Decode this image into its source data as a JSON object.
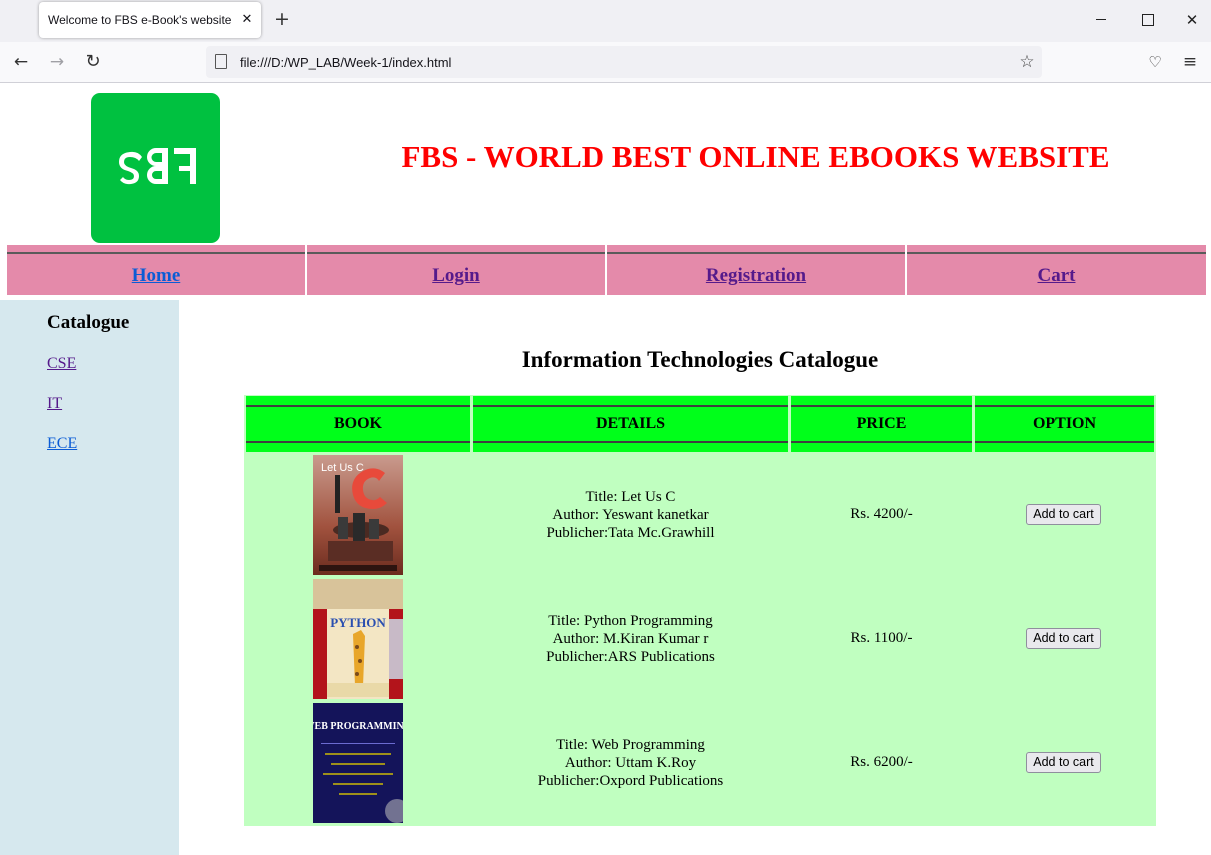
{
  "browser": {
    "tab_title": "Welcome to FBS e-Book's website",
    "tab_close": "✕",
    "new_tab": "+",
    "url": "file:///D:/WP_LAB/Week-1/index.html"
  },
  "header": {
    "logo_text": "FBS",
    "site_title": "FBS - WORLD BEST ONLINE EBOOKS WEBSITE"
  },
  "nav": {
    "items": [
      {
        "label": "Home"
      },
      {
        "label": "Login"
      },
      {
        "label": "Registration"
      },
      {
        "label": "Cart"
      }
    ]
  },
  "sidebar": {
    "title": "Catalogue",
    "links": [
      {
        "label": "CSE"
      },
      {
        "label": "IT"
      },
      {
        "label": "ECE"
      }
    ]
  },
  "catalogue": {
    "title": "Information Technologies Catalogue",
    "columns": [
      "BOOK",
      "DETAILS",
      "PRICE",
      "OPTION"
    ],
    "books": [
      {
        "cover_text": "Let Us C",
        "title": "Title: Let Us C",
        "author": "Author: Yeswant kanetkar",
        "publisher": "Publicher:Tata Mc.Grawhill",
        "price": "Rs. 4200/-",
        "button": "Add to cart"
      },
      {
        "cover_text": "PYTHON",
        "title": "Title: Python Programming",
        "author": "Author: M.Kiran Kumar r",
        "publisher": "Publicher:ARS Publications",
        "price": "Rs. 1100/-",
        "button": "Add to cart"
      },
      {
        "cover_text": "WEB PROGRAMMING",
        "title": "Title: Web Programming",
        "author": "Author: Uttam K.Roy",
        "publisher": "Publicher:Oxpord Publications",
        "price": "Rs. 6200/-",
        "button": "Add to cart"
      }
    ]
  },
  "colors": {
    "title_red": "#ff0000",
    "nav_pink": "#e48aaa",
    "sidebar_blue": "#d6e8ee",
    "table_header_green": "#00ff1a",
    "table_body_green": "#c0ffc0",
    "logo_green": "#00c140"
  }
}
